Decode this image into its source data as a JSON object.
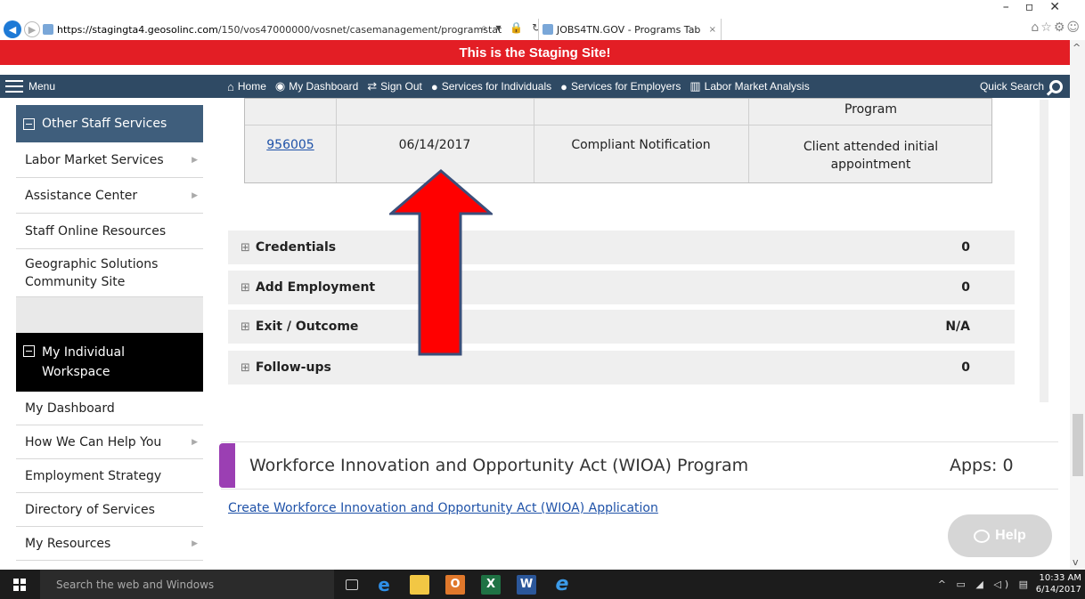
{
  "browser": {
    "url_host": "https://stagingta4.geosolinc.com",
    "url_path": "/150/vos47000000/vosnet/casemanagement/programstat",
    "tab_title": "JOBS4TN.GOV - Programs Tab",
    "tab_close": "×",
    "address_tools": "⌕ ▾ 🔒 ↻"
  },
  "banner": {
    "text": "This is the Staging Site!"
  },
  "nav": {
    "menu_label": "Menu",
    "links": [
      {
        "icon": "⌂",
        "label": "Home"
      },
      {
        "icon": "◉",
        "label": "My Dashboard"
      },
      {
        "icon": "⇄",
        "label": "Sign Out"
      },
      {
        "icon": "●",
        "label": "Services for Individuals"
      },
      {
        "icon": "●",
        "label": "Services for Employers"
      },
      {
        "icon": "▥",
        "label": "Labor Market Analysis"
      }
    ],
    "quick_search": "Quick Search"
  },
  "sidebar": {
    "staff_header": "Other Staff Services",
    "staff_items": [
      {
        "label": "Labor Market Services",
        "has_arrow": true
      },
      {
        "label": "Assistance Center",
        "has_arrow": true
      },
      {
        "label": "Staff Online Resources",
        "has_arrow": false
      }
    ],
    "geo_item": {
      "line1": "Geographic Solutions",
      "line2": "Community Site"
    },
    "workspace_header_line1": "My Individual",
    "workspace_header_line2": "Workspace",
    "workspace_items": [
      {
        "label": "My Dashboard",
        "has_arrow": false
      },
      {
        "label": "How We Can Help You",
        "has_arrow": true
      },
      {
        "label": "Employment Strategy",
        "has_arrow": false
      },
      {
        "label": "Directory of Services",
        "has_arrow": false
      },
      {
        "label": "My Resources",
        "has_arrow": true
      }
    ]
  },
  "table": {
    "top_row_text": "Program",
    "row": {
      "id": "956005",
      "date": "06/14/2017",
      "type": "Compliant Notification",
      "status_line1": "Client attended initial",
      "status_line2": "appointment"
    }
  },
  "accordions": [
    {
      "label": "Credentials",
      "count": "0"
    },
    {
      "label": "Add Employment",
      "count": "0"
    },
    {
      "label": "Exit / Outcome",
      "count": "N/A"
    },
    {
      "label": "Follow-ups",
      "count": "0"
    }
  ],
  "wioa": {
    "title": "Workforce Innovation and Opportunity Act (WIOA) Program",
    "apps": "Apps: 0",
    "create_link": "Create Workforce Innovation and Opportunity Act (WIOA) Application"
  },
  "help": {
    "label": "Help"
  },
  "taskbar": {
    "search_placeholder": "Search the web and Windows",
    "time": "10:33 AM",
    "date": "6/14/2017",
    "tray_icons": "^ ▭ ◢ ◁) ▤"
  },
  "colors": {
    "banner": "#e31e25",
    "navbar": "#2f4a64",
    "sidebar_header": "#3f5e7c",
    "link": "#1f52a8",
    "wioa_accent": "#9b3fb3",
    "annotation_arrow": "#ff0000"
  }
}
